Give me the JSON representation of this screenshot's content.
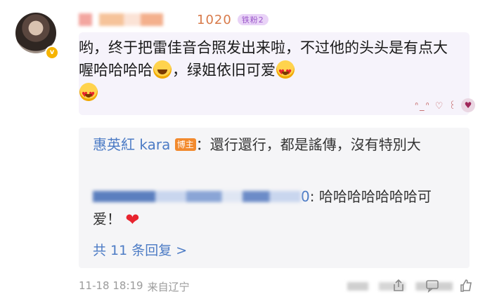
{
  "comment": {
    "username_suffix": "1020",
    "fan_badge": "铁粉2",
    "text_part1": "哟，终于把雷佳音合照发出来啦，不过他的头头是有点大喔哈哈哈哈",
    "text_part2": "，绿姐依旧可爱",
    "decor_text": "ᐢ_ᐢ ♡ ꒰ ꒱"
  },
  "replies": [
    {
      "name": "惠英紅 kara",
      "badge": "博主",
      "text": "：還行還行，都是謠傳，沒有特別大"
    },
    {
      "name_suffix": "0",
      "text": ": 哈哈哈哈哈哈哈可爱！"
    }
  ],
  "more_replies": "共 11 条回复 >",
  "footer": {
    "time": "11-18 18:19",
    "location": "来自辽宁"
  },
  "icons": {
    "verified": "verified-icon",
    "share": "share-icon",
    "comment": "comment-icon",
    "like": "like-icon"
  }
}
